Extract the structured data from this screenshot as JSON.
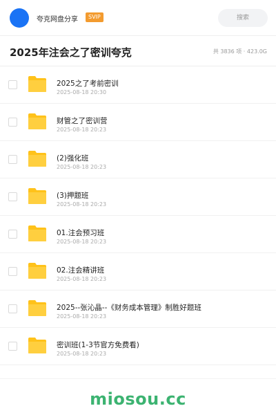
{
  "top_bar": {
    "share_name": "夸克网盘分享",
    "badge": "SVIP",
    "search_label": "搜索"
  },
  "header": {
    "title": "2025年注会之了密训夸克",
    "meta": "共 3836 项 · 423.0G"
  },
  "files": [
    {
      "name": "2025之了考前密训",
      "date": "2025-08-18 20:30",
      "icon": "folder-icon"
    },
    {
      "name": "财管之了密训营",
      "date": "2025-08-18 20:23",
      "icon": "folder-icon"
    },
    {
      "name": "(2)强化班",
      "date": "2025-08-18 20:23",
      "icon": "folder-icon"
    },
    {
      "name": "(3)押题班",
      "date": "2025-08-18 20:23",
      "icon": "folder-icon"
    },
    {
      "name": "01.注会预习班",
      "date": "2025-08-18 20:23",
      "icon": "folder-icon"
    },
    {
      "name": "02.注会精讲班",
      "date": "2025-08-18 20:23",
      "icon": "folder-icon"
    },
    {
      "name": "2025--张沁晶--《财务成本管理》制胜好题班",
      "date": "2025-08-18 20:23",
      "icon": "folder-icon"
    },
    {
      "name": "密训班(1-3节官方免费看)",
      "date": "2025-08-18 20:23",
      "icon": "folder-icon"
    }
  ],
  "watermark": "miosou.cc",
  "colors": {
    "avatar": "#1a73f5",
    "badge": "#f39b2f",
    "folder": "#ffc21a",
    "watermark": "#3cb371"
  }
}
